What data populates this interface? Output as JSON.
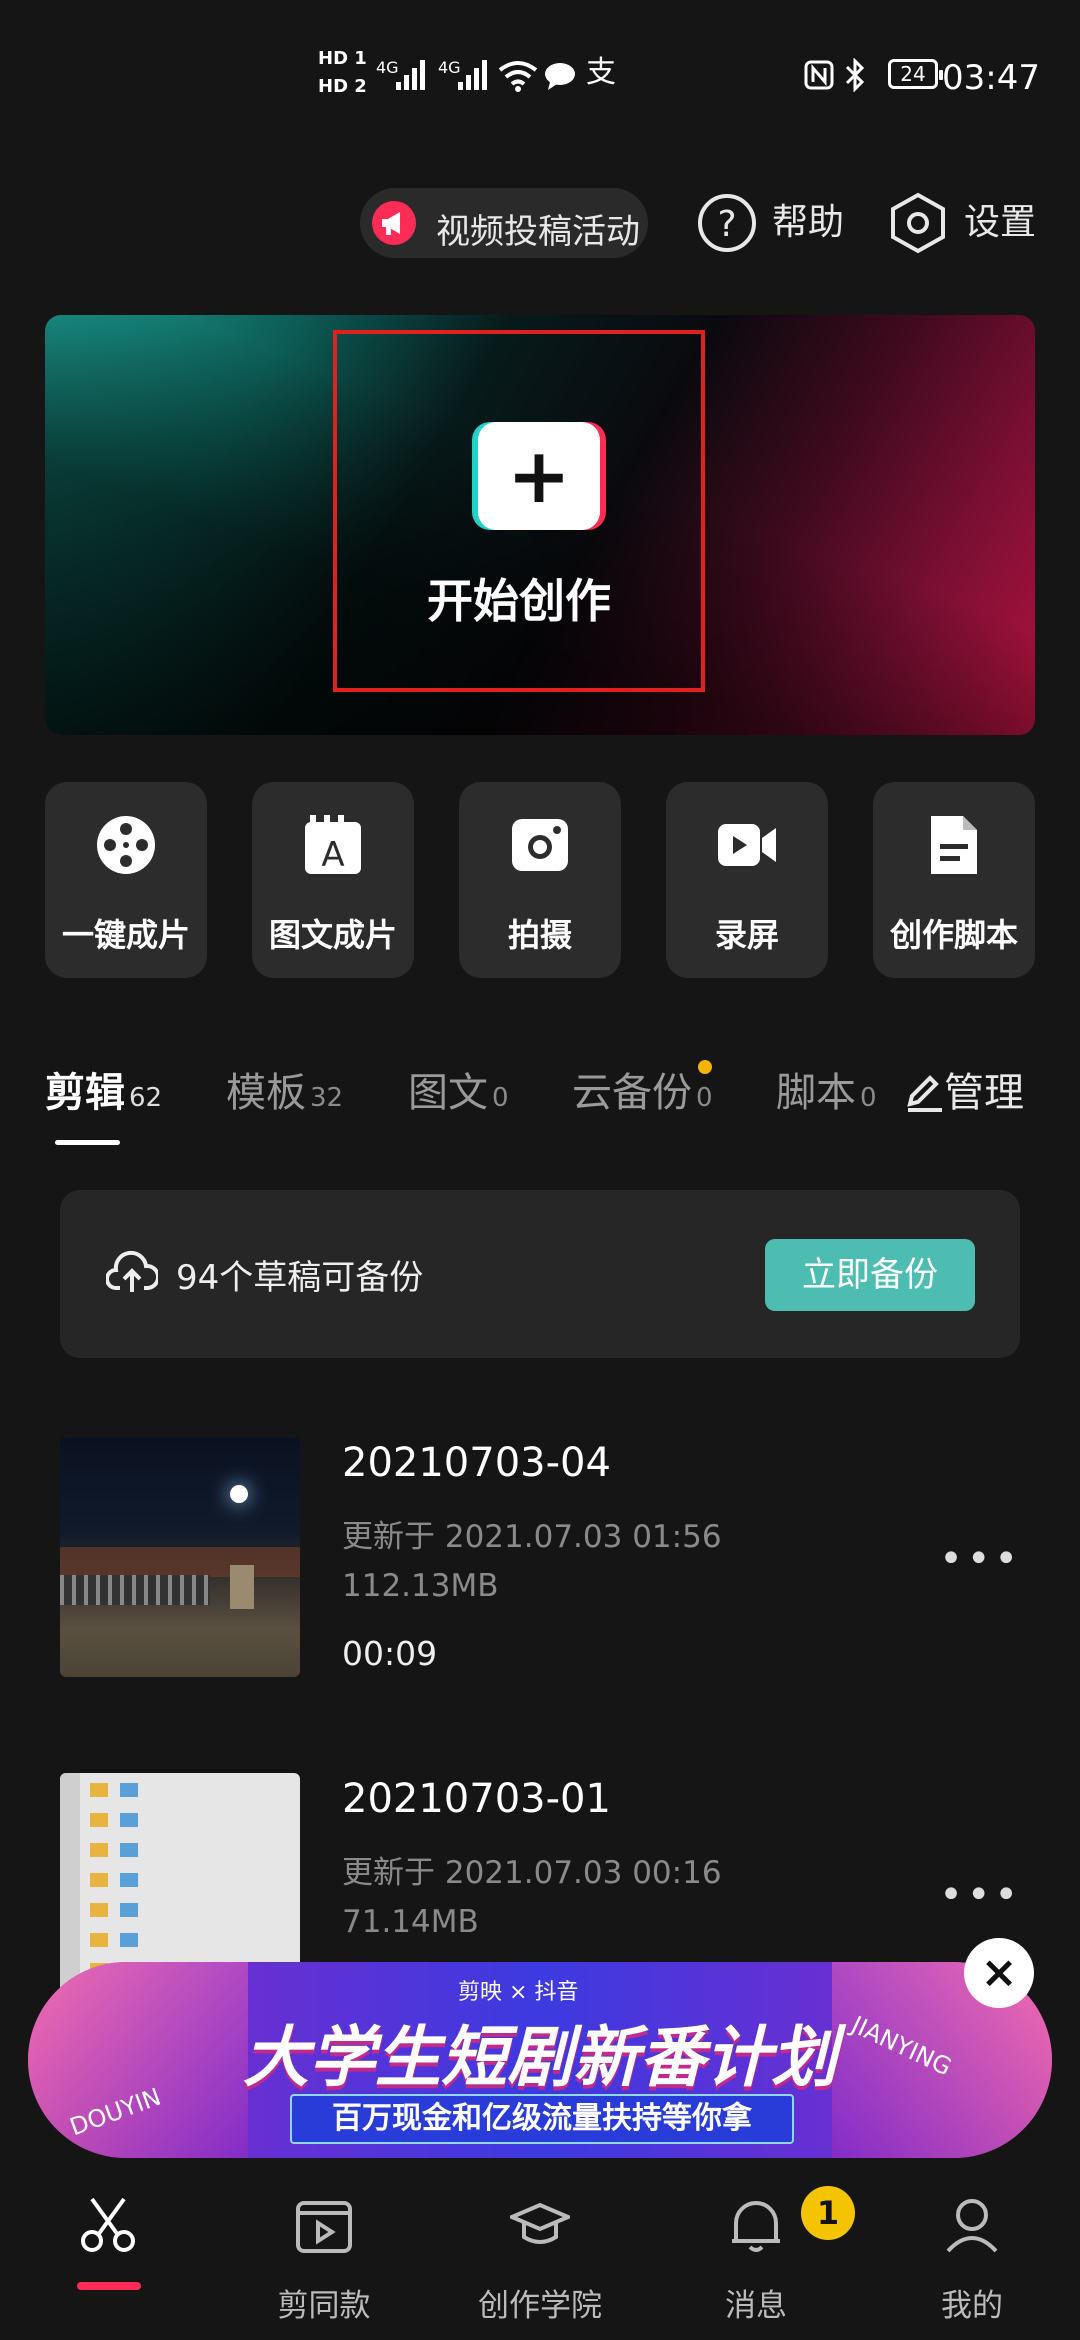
{
  "status_bar": {
    "time": "03:47",
    "battery": "24",
    "hd1": "HD 1",
    "hd2": "HD 2",
    "net1": "4G",
    "net2": "4G"
  },
  "header": {
    "campaign_label": "视频投稿活动",
    "help_label": "帮助",
    "settings_label": "设置"
  },
  "banner": {
    "create_label": "开始创作",
    "plus": "+"
  },
  "tools": [
    {
      "label": "一键成片",
      "icon": "film-reel-icon"
    },
    {
      "label": "图文成片",
      "icon": "text-image-icon"
    },
    {
      "label": "拍摄",
      "icon": "camera-icon"
    },
    {
      "label": "录屏",
      "icon": "screen-record-icon"
    },
    {
      "label": "创作脚本",
      "icon": "script-document-icon"
    }
  ],
  "tabs": [
    {
      "label": "剪辑",
      "count": "62"
    },
    {
      "label": "模板",
      "count": "32"
    },
    {
      "label": "图文",
      "count": "0"
    },
    {
      "label": "云备份",
      "count": "0"
    },
    {
      "label": "脚本",
      "count": "0"
    }
  ],
  "manage_label": "管理",
  "backup": {
    "text": "94个草稿可备份",
    "button": "立即备份"
  },
  "drafts": [
    {
      "title": "20210703-04",
      "updated": "更新于 2021.07.03 01:56",
      "size": "112.13MB",
      "duration": "00:09"
    },
    {
      "title": "20210703-01",
      "updated": "更新于 2021.07.03 00:16",
      "size": "71.14MB",
      "duration": ""
    }
  ],
  "ad": {
    "brand_left": "剪映",
    "brand_x": "×",
    "brand_right": "抖音",
    "headline": "大学生短剧新番计划",
    "subline": "百万现金和亿级流量扶持等你拿",
    "side_left": "DOUYIN",
    "side_right": "JIANYING",
    "close": "×"
  },
  "nav": [
    {
      "label": "",
      "icon": "scissors-icon"
    },
    {
      "label": "剪同款",
      "icon": "template-video-icon"
    },
    {
      "label": "创作学院",
      "icon": "graduation-cap-icon"
    },
    {
      "label": "消息",
      "icon": "bell-icon"
    },
    {
      "label": "我的",
      "icon": "profile-icon"
    }
  ],
  "message_badge": "1",
  "colors": {
    "accent_teal": "#4dbdb2",
    "accent_red": "#ff2c55",
    "badge_yellow": "#f5c400"
  }
}
